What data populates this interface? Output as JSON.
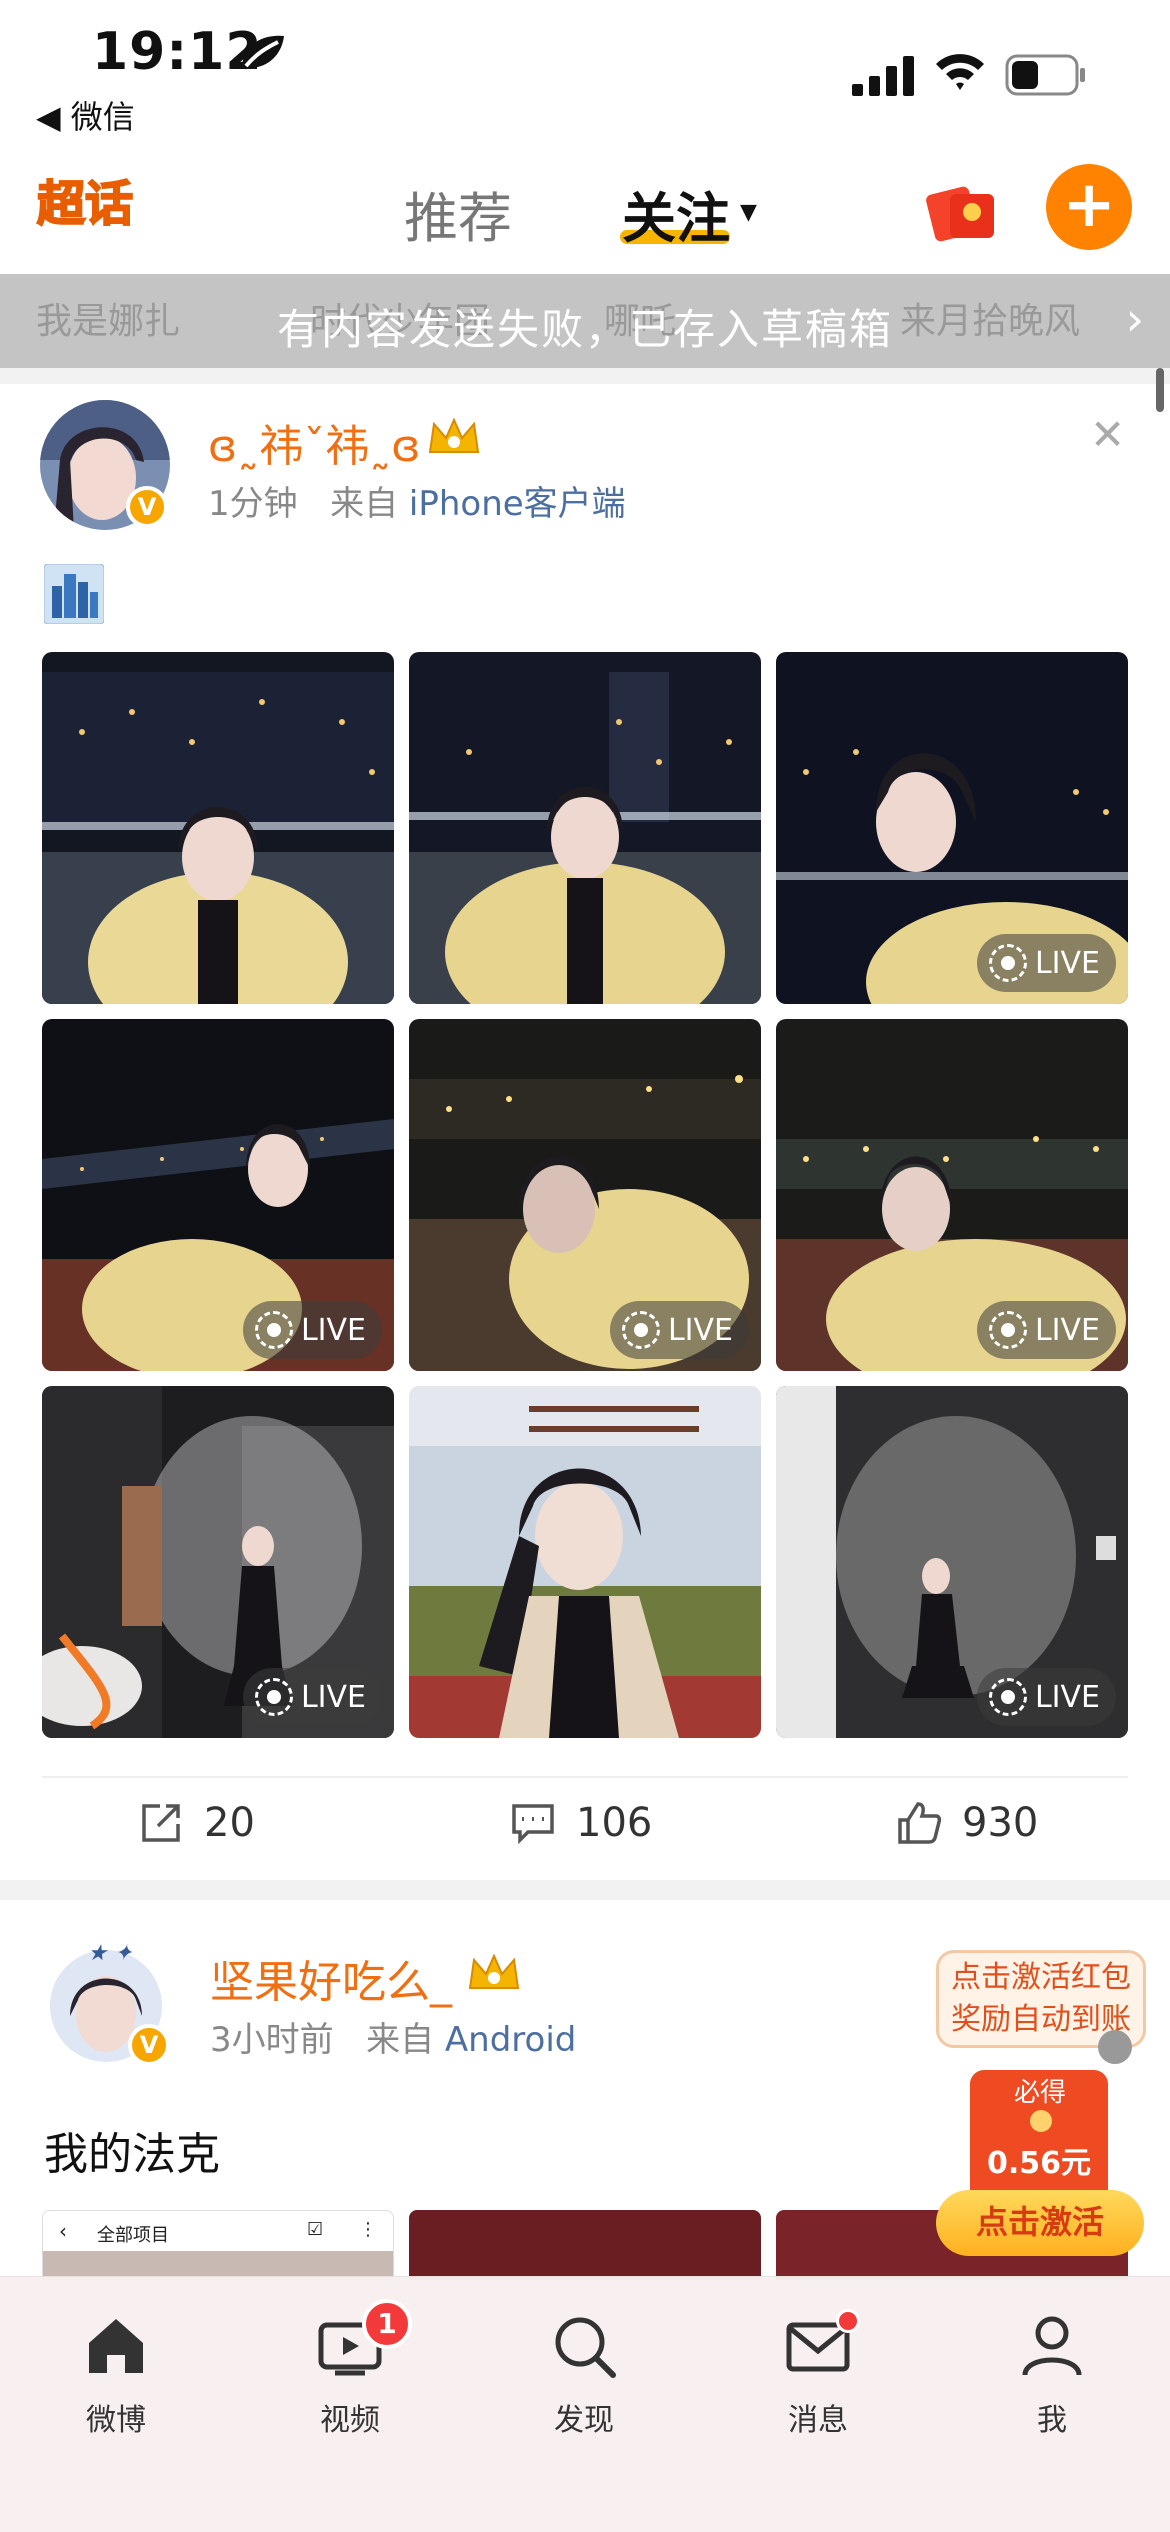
{
  "status_bar": {
    "time": "19:12",
    "back_app": "◀ 微信"
  },
  "top_nav": {
    "logo_text": "超话",
    "tabs": [
      {
        "label": "推荐"
      },
      {
        "label": "关注"
      }
    ],
    "plus_symbol": "+"
  },
  "toast": {
    "message": "有内容发送失败，已存入草稿箱",
    "background_hints": [
      "我是娜扎",
      "时代少年团",
      "哪吒",
      "来月拾晚风"
    ]
  },
  "posts": [
    {
      "author": "ɞ˷祎ˇ祎˷ɞ",
      "time": "1分钟",
      "from_label": "来自",
      "source": "iPhone客户端",
      "live_label": "LIVE",
      "photos": [
        {
          "live": false
        },
        {
          "live": false
        },
        {
          "live": true
        },
        {
          "live": true
        },
        {
          "live": true
        },
        {
          "live": true
        },
        {
          "live": true
        },
        {
          "live": false
        },
        {
          "live": true
        }
      ],
      "actions": {
        "reposts": "20",
        "comments": "106",
        "likes": "930"
      }
    },
    {
      "author": "坚果好吃么_",
      "time": "3小时前",
      "from_label": "来自",
      "source": "Android",
      "text": "我的法克",
      "thumb_header": "全部项目"
    }
  ],
  "promo": {
    "bubble_line1": "点击激活红包",
    "bubble_line2": "奖励自动到账",
    "must_get": "必得",
    "amount": "0.56元",
    "button": "点击激活"
  },
  "tabbar": {
    "items": [
      {
        "label": "微博",
        "icon": "home-icon"
      },
      {
        "label": "视频",
        "icon": "video-icon",
        "badge": "1"
      },
      {
        "label": "发现",
        "icon": "search-icon"
      },
      {
        "label": "消息",
        "icon": "mail-icon",
        "dot": true
      },
      {
        "label": "我",
        "icon": "profile-icon"
      }
    ]
  },
  "colors": {
    "accent": "#ff8200",
    "author": "#f06f12",
    "source": "#4c6ea0",
    "badge": "#f23a3a"
  }
}
